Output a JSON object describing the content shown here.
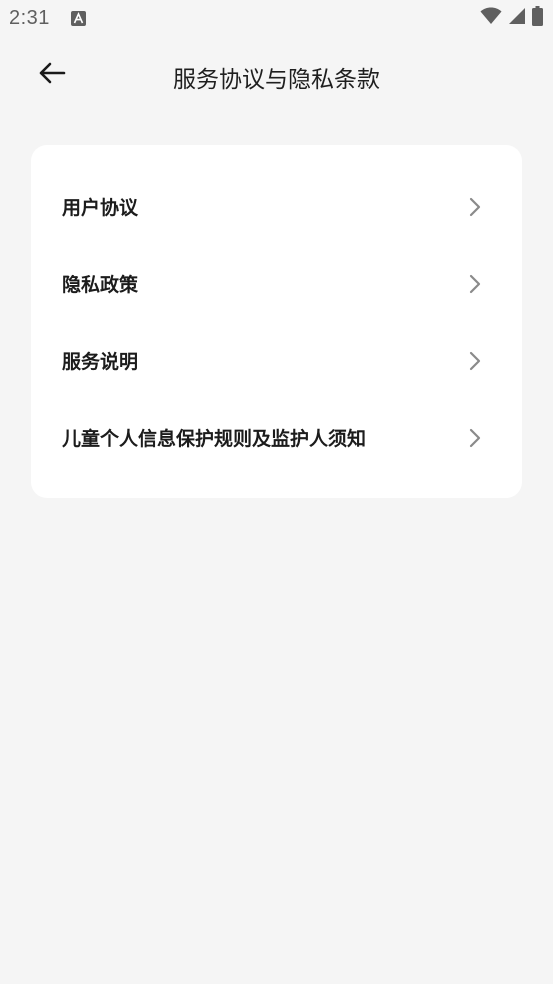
{
  "status_bar": {
    "time": "2:31",
    "notification_icon": "font-a-icon",
    "icons": [
      "wifi-icon",
      "signal-icon",
      "battery-icon"
    ]
  },
  "header": {
    "back_icon": "arrow-left-icon",
    "title": "服务协议与隐私条款"
  },
  "menu": {
    "items": [
      {
        "label": "用户协议",
        "icon": "chevron-right-icon"
      },
      {
        "label": "隐私政策",
        "icon": "chevron-right-icon"
      },
      {
        "label": "服务说明",
        "icon": "chevron-right-icon"
      },
      {
        "label": "儿童个人信息保护规则及监护人须知",
        "icon": "chevron-right-icon"
      }
    ]
  },
  "colors": {
    "background": "#f5f5f5",
    "card": "#ffffff",
    "text": "#1c1c1c",
    "chevron": "#8a8a8a",
    "status_icons": "#5f5f5f"
  }
}
